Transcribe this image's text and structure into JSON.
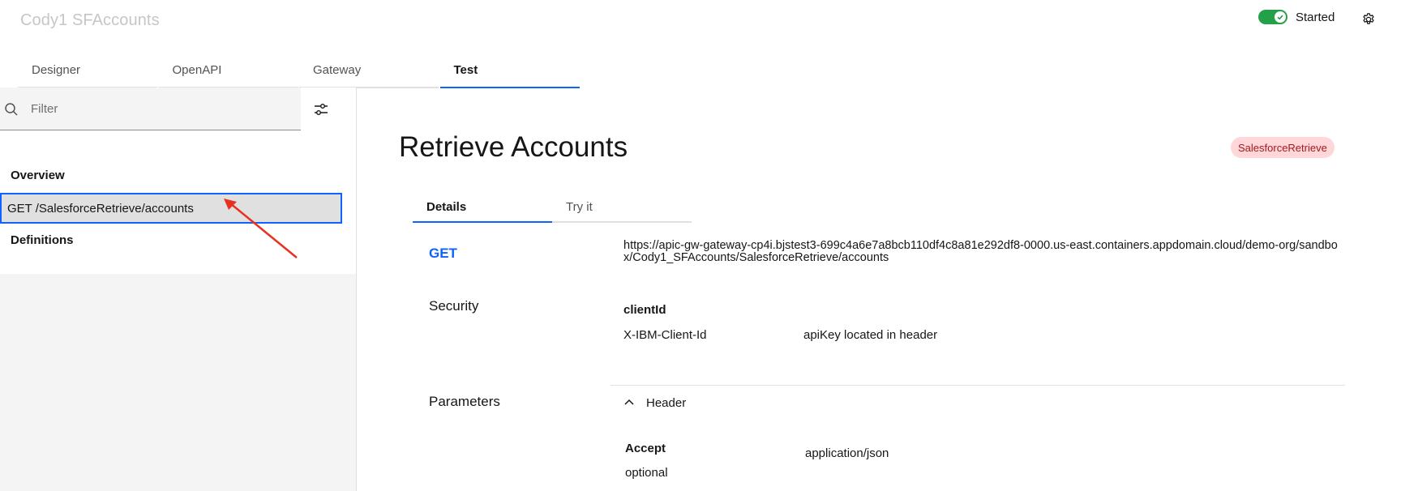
{
  "header": {
    "app_title": "Cody1 SFAccounts",
    "status_label": "Started"
  },
  "tabs": [
    {
      "label": "Designer"
    },
    {
      "label": "OpenAPI"
    },
    {
      "label": "Gateway"
    },
    {
      "label": "Test"
    }
  ],
  "sidebar": {
    "filter_placeholder": "Filter",
    "overview": "Overview",
    "operation": "GET /SalesforceRetrieve/accounts",
    "definitions": "Definitions"
  },
  "main": {
    "title": "Retrieve Accounts",
    "tag": "SalesforceRetrieve",
    "inner_tabs": [
      {
        "label": "Details"
      },
      {
        "label": "Try it"
      }
    ],
    "method": "GET",
    "url": "https://apic-gw-gateway-cp4i.bjstest3-699c4a6e7a8bcb110df4c8a81e292df8-0000.us-east.containers.appdomain.cloud/demo-org/sandbox/Cody1_SFAccounts/SalesforceRetrieve/accounts",
    "security": {
      "label": "Security",
      "name": "clientId",
      "header": "X-IBM-Client-Id",
      "description": "apiKey located in header"
    },
    "parameters": {
      "label": "Parameters",
      "group": "Header",
      "name": "Accept",
      "required": "optional",
      "value": "application/json"
    }
  },
  "colors": {
    "accent": "#0f62fe",
    "toggle_on": "#24a148",
    "tag_bg": "#ffd7d9",
    "tag_text": "#a2191f",
    "annotation_arrow": "#e8321f"
  }
}
